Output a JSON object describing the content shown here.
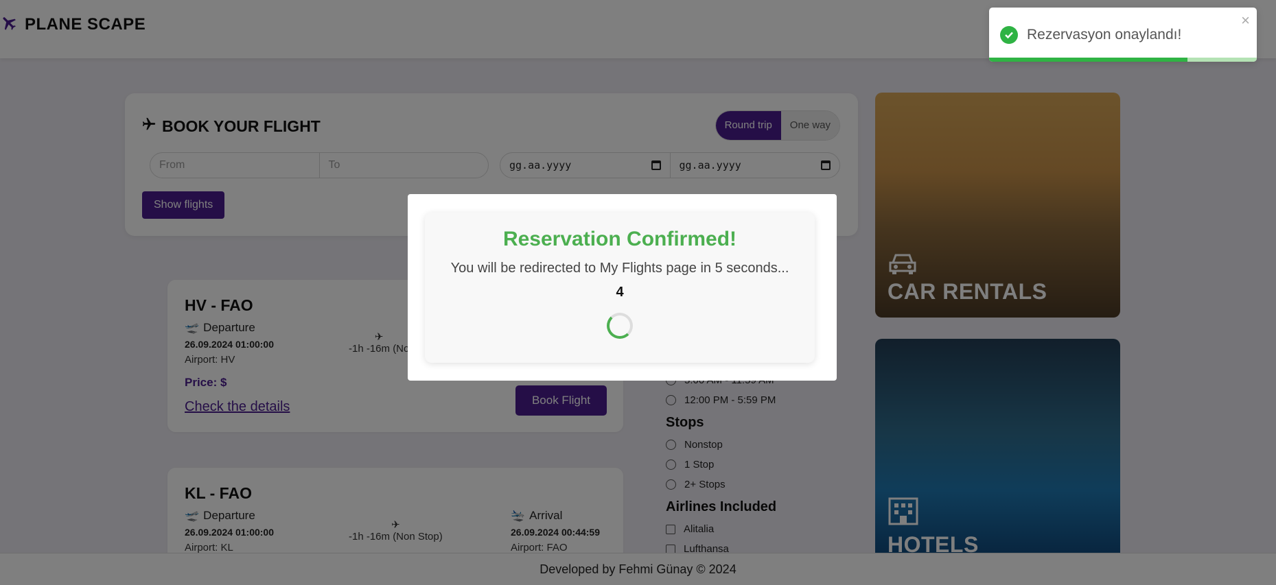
{
  "app": {
    "logo_text": "PLANE SCAPE"
  },
  "booking": {
    "title": "BOOK YOUR FLIGHT",
    "trip_round": "Round trip",
    "trip_one": "One way",
    "from_placeholder": "From",
    "to_placeholder": "To",
    "date1": "gg.aa.yyyy",
    "date2": "gg.aa.yyyy",
    "show_flights": "Show flights"
  },
  "flights": [
    {
      "route": "HV - FAO",
      "departure_label": "Departure",
      "departure_datetime": "26.09.2024 01:00:00",
      "departure_airport": "Airport: HV",
      "duration": "-1h -16m (No",
      "price": "Price: $",
      "details": "Check the details",
      "book": "Book Flight"
    },
    {
      "route": "KL - FAO",
      "departure_label": "Departure",
      "departure_datetime": "26.09.2024 01:00:00",
      "departure_airport": "Airport: KL",
      "duration": "-1h -16m (Non Stop)",
      "arrival_label": "Arrival",
      "arrival_datetime": "26.09.2024 00:44:59",
      "arrival_airport": "Airport: FAO"
    }
  ],
  "filters": {
    "time_options": [
      "5:00 AM - 11:59 AM",
      "12:00 PM - 5:59 PM"
    ],
    "stops_heading": "Stops",
    "stops": [
      "Nonstop",
      "1 Stop",
      "2+ Stops"
    ],
    "airlines_heading": "Airlines Included",
    "airlines": [
      "Alitalia",
      "Lufthansa"
    ]
  },
  "promos": {
    "car": "CAR RENTALS",
    "hotels": "HOTELS"
  },
  "footer": "Developed by Fehmi Günay © 2024",
  "modal": {
    "title": "Reservation Confirmed!",
    "message": "You will be redirected to My Flights page in 5 seconds...",
    "countdown": "4"
  },
  "toast": {
    "message": "Rezervasyon onaylandı!",
    "close": "×",
    "progress": 0.74
  },
  "colors": {
    "accent": "#4b1d8f",
    "success": "#4caf50",
    "toast_green": "#2fb344"
  }
}
